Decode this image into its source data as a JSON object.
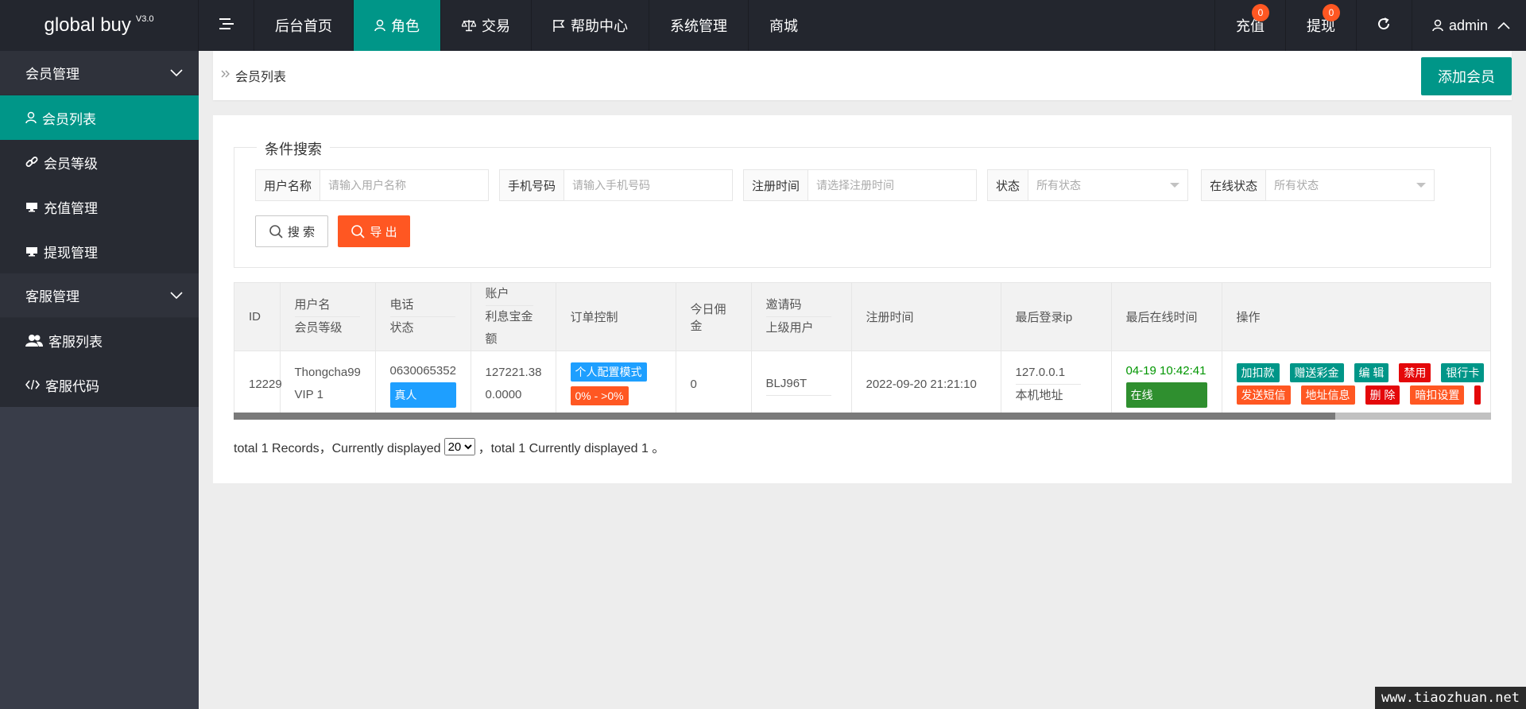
{
  "app": {
    "name": "global buy",
    "version": "V3.0"
  },
  "topnav": {
    "items": [
      {
        "label": "后台首页"
      },
      {
        "label": "角色"
      },
      {
        "label": "交易"
      },
      {
        "label": "帮助中心"
      },
      {
        "label": "系统管理"
      },
      {
        "label": "商城"
      }
    ],
    "right": {
      "recharge": {
        "label": "充值",
        "badge": "0"
      },
      "withdraw": {
        "label": "提现",
        "badge": "0"
      },
      "user": "admin"
    }
  },
  "sidebar": {
    "groups": [
      {
        "label": "会员管理"
      },
      {
        "label": "客服管理"
      }
    ],
    "items": [
      {
        "label": "会员列表"
      },
      {
        "label": "会员等级"
      },
      {
        "label": "充值管理"
      },
      {
        "label": "提现管理"
      },
      {
        "label": "客服列表"
      },
      {
        "label": "客服代码"
      }
    ]
  },
  "breadcrumb": {
    "current": "会员列表"
  },
  "add_button": "添加会员",
  "search": {
    "legend": "条件搜索",
    "fields": [
      {
        "label": "用户名称",
        "placeholder": "请输入用户名称"
      },
      {
        "label": "手机号码",
        "placeholder": "请输入手机号码"
      },
      {
        "label": "注册时间",
        "placeholder": "请选择注册时间"
      },
      {
        "label": "状态",
        "value": "所有状态"
      },
      {
        "label": "在线状态",
        "value": "所有状态"
      }
    ],
    "search_button": "搜 索",
    "export_button": "导 出"
  },
  "table": {
    "headers": {
      "id": "ID",
      "username": "用户名",
      "level": "会员等级",
      "phone": "电话",
      "status": "状态",
      "account": "账户",
      "interest": "利息宝金额",
      "order_control": "订单控制",
      "today_commission": "今日佣金",
      "invite_code": "邀请码",
      "parent_user": "上级用户",
      "register_time": "注册时间",
      "last_login_ip": "最后登录ip",
      "last_online": "最后在线时间",
      "actions": "操作"
    },
    "rows": [
      {
        "id": "12229",
        "username": "Thongcha99",
        "level": "VIP 1",
        "phone": "0630065352",
        "status": "真人",
        "account": "127221.38",
        "interest": "0.0000",
        "order_mode": "个人配置模式",
        "order_range": "0% - >0%",
        "today_commission": "0",
        "invite_code": "BLJ96T",
        "parent_user": "",
        "register_time": "2022-09-20 21:21:10",
        "last_login_ip": "127.0.0.1",
        "ip_location": "本机地址",
        "last_online": "04-19 10:42:41",
        "online_status": "在线",
        "actions_row1": [
          "加扣款",
          "赠送彩金",
          "编 辑",
          "禁用",
          "银行卡"
        ],
        "actions_row2": [
          "发送短信",
          "地址信息",
          "删 除",
          "暗扣设置"
        ]
      }
    ]
  },
  "pager": {
    "prefix": "total 1 Records，Currently displayed",
    "page_size": "20",
    "page_size_options": [
      "20"
    ],
    "suffix": "，total 1 Currently displayed 1 。"
  },
  "watermark": "www.tiaozhuan.net",
  "colors": {
    "primary": "#009688",
    "danger": "#ff5722",
    "topbar": "#23262e",
    "sidebar": "#393d49"
  }
}
